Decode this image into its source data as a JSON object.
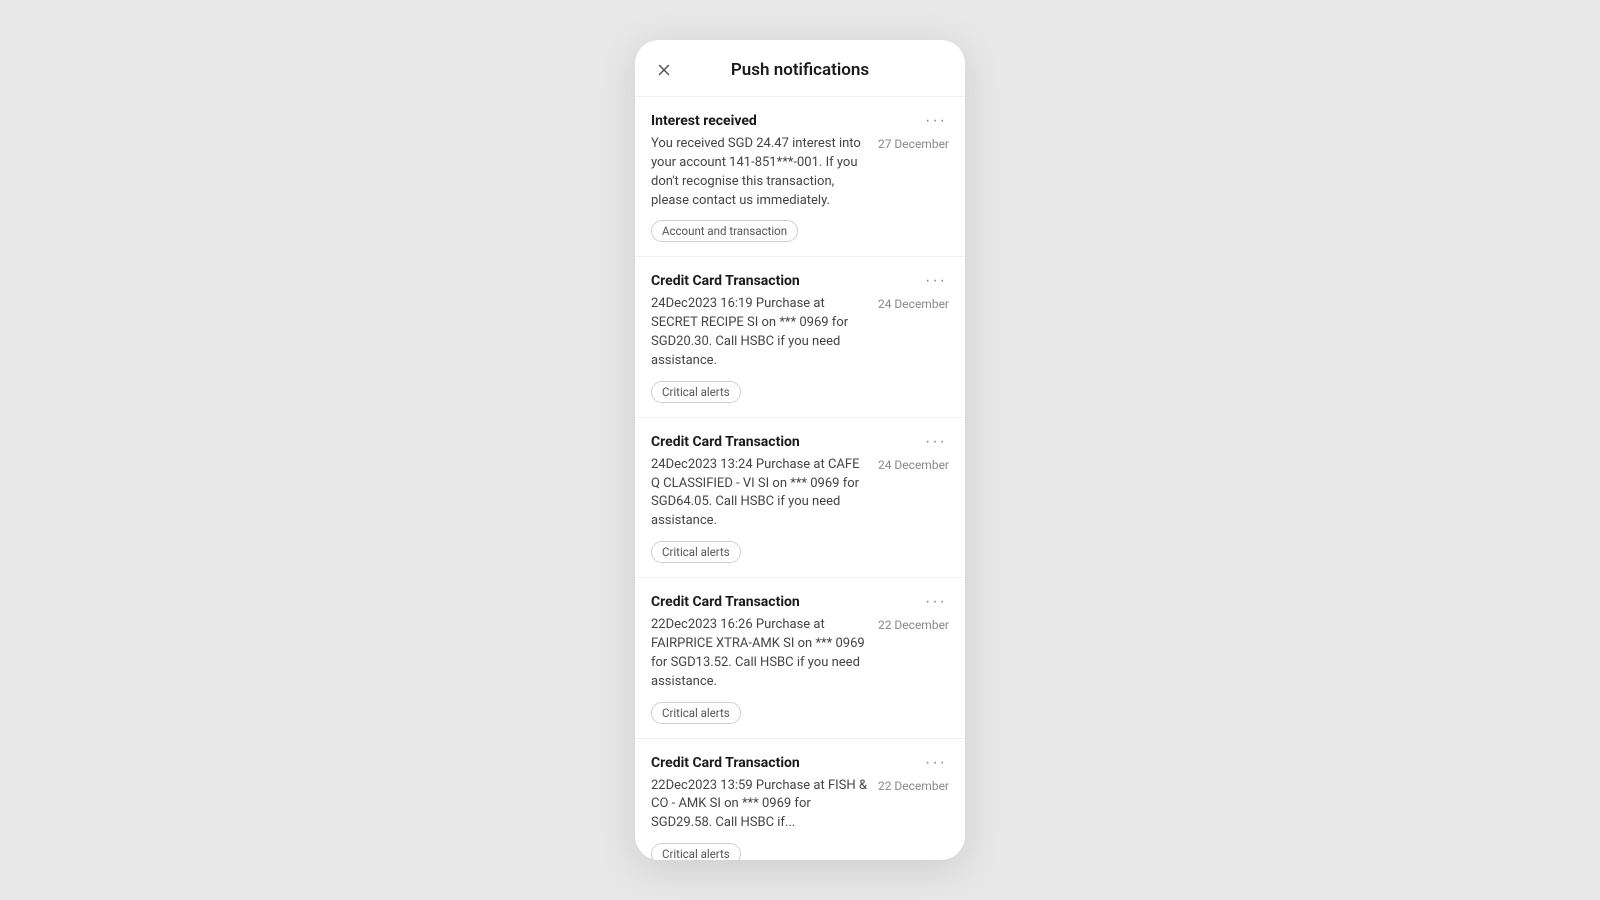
{
  "header": {
    "title": "Push notifications",
    "close_label": "close"
  },
  "notifications": [
    {
      "id": "notif-1",
      "title": "Interest received",
      "body": "You received SGD 24.47 interest into your account 141-851***-001. If you don't recognise this transaction, please contact us immediately.",
      "date": "27 December",
      "tag": "Account and transaction",
      "menu_label": "more options"
    },
    {
      "id": "notif-2",
      "title": "Credit Card Transaction",
      "body": "24Dec2023 16:19 Purchase at SECRET RECIPE      SI on *** 0969 for SGD20.30. Call HSBC if you need assistance.",
      "date": "24 December",
      "tag": "Critical alerts",
      "menu_label": "more options"
    },
    {
      "id": "notif-3",
      "title": "Credit Card Transaction",
      "body": "24Dec2023 13:24 Purchase at CAFE Q CLASSIFIED - VI SI on *** 0969 for SGD64.05. Call HSBC if you need assistance.",
      "date": "24 December",
      "tag": "Critical alerts",
      "menu_label": "more options"
    },
    {
      "id": "notif-4",
      "title": "Credit Card Transaction",
      "body": "22Dec2023 16:26 Purchase at FAIRPRICE XTRA-AMK      SI on *** 0969 for SGD13.52. Call HSBC if you need assistance.",
      "date": "22 December",
      "tag": "Critical alerts",
      "menu_label": "more options"
    },
    {
      "id": "notif-5",
      "title": "Credit Card Transaction",
      "body": "22Dec2023 13:59 Purchase at FISH & CO - AMK      SI on *** 0969 for SGD29.58. Call HSBC if...",
      "date": "22 December",
      "tag": "Critical alerts",
      "menu_label": "more options"
    }
  ]
}
